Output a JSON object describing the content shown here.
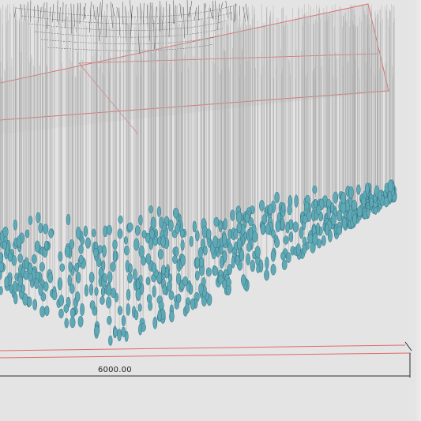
{
  "viewport": {
    "dimension": {
      "label": "6000.00",
      "unit_line_color": "#2b2b2b",
      "guide_color": "#e26060"
    },
    "colors": {
      "background": "#e4e4e4",
      "rod": "#a9a9a9",
      "crystal": "#5fa9b6",
      "crystal_dark": "#2f6f7c",
      "canopy_line": "#4a4a4a",
      "frame_red": "#e06a6a"
    },
    "model": {
      "name": "crystal-chandelier-3d-model"
    }
  }
}
